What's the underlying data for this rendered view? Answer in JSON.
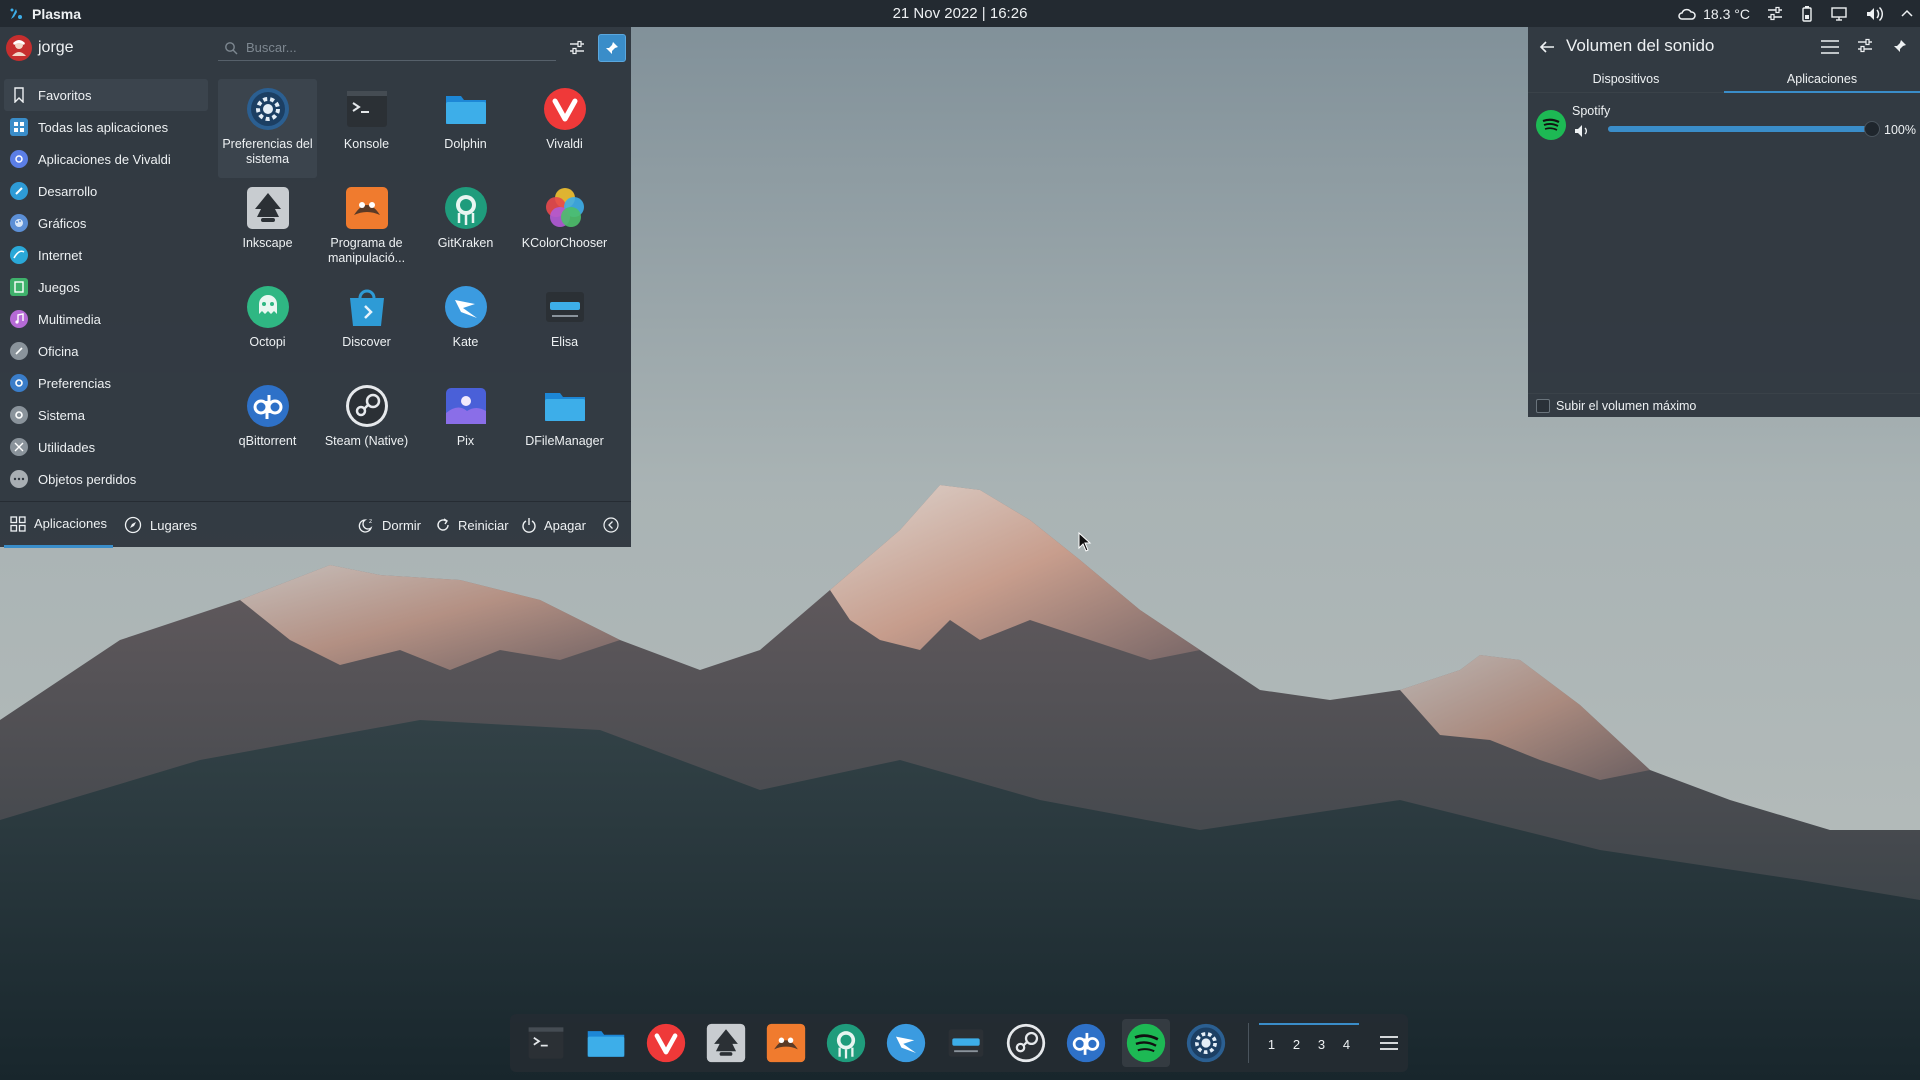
{
  "top_panel": {
    "launcher_label": "Plasma",
    "clock": "21 Nov 2022 | 16:26",
    "weather_temp": "18.3 °C",
    "tray_icons": [
      "weather-icon",
      "settings-sliders-icon",
      "battery-icon",
      "display-icon",
      "volume-icon",
      "chevron-up-icon"
    ]
  },
  "launcher": {
    "user_name": "jorge",
    "search_placeholder": "Buscar...",
    "categories": [
      {
        "label": "Favoritos",
        "icon": "bookmark-icon",
        "color": "#2d353c"
      },
      {
        "label": "Todas las aplicaciones",
        "icon": "grid-icon",
        "color": "#3a8dc9"
      },
      {
        "label": "Aplicaciones de Vivaldi",
        "icon": "vivaldi-folder-icon",
        "color": "#5b7ee6"
      },
      {
        "label": "Desarrollo",
        "icon": "development-icon",
        "color": "#2e9bd6"
      },
      {
        "label": "Gráficos",
        "icon": "graphics-icon",
        "color": "#5c8fd6"
      },
      {
        "label": "Internet",
        "icon": "internet-icon",
        "color": "#2aa8d8"
      },
      {
        "label": "Juegos",
        "icon": "games-icon",
        "color": "#3fb16b"
      },
      {
        "label": "Multimedia",
        "icon": "multimedia-icon",
        "color": "#b66ad6"
      },
      {
        "label": "Oficina",
        "icon": "office-icon",
        "color": "#8a939b"
      },
      {
        "label": "Preferencias",
        "icon": "preferences-icon",
        "color": "#3a7dc9"
      },
      {
        "label": "Sistema",
        "icon": "system-icon",
        "color": "#8a939b"
      },
      {
        "label": "Utilidades",
        "icon": "utilities-icon",
        "color": "#8a939b"
      },
      {
        "label": "Objetos perdidos",
        "icon": "lost-found-icon",
        "color": "#a8aeb3"
      }
    ],
    "apps": [
      {
        "label": "Preferencias del sistema",
        "icon": "system-settings-icon"
      },
      {
        "label": "Konsole",
        "icon": "konsole-icon"
      },
      {
        "label": "Dolphin",
        "icon": "dolphin-folder-icon"
      },
      {
        "label": "Vivaldi",
        "icon": "vivaldi-icon"
      },
      {
        "label": "Inkscape",
        "icon": "inkscape-icon"
      },
      {
        "label": "Programa de manipulació...",
        "icon": "gimp-icon"
      },
      {
        "label": "GitKraken",
        "icon": "gitkraken-icon"
      },
      {
        "label": "KColorChooser",
        "icon": "kcolorchooser-icon"
      },
      {
        "label": "Octopi",
        "icon": "octopi-icon"
      },
      {
        "label": "Discover",
        "icon": "discover-icon"
      },
      {
        "label": "Kate",
        "icon": "kate-icon"
      },
      {
        "label": "Elisa",
        "icon": "elisa-icon"
      },
      {
        "label": "qBittorrent",
        "icon": "qbittorrent-icon"
      },
      {
        "label": "Steam (Native)",
        "icon": "steam-icon"
      },
      {
        "label": "Pix",
        "icon": "pix-icon"
      },
      {
        "label": "DFileManager",
        "icon": "dfilemanager-icon"
      }
    ],
    "footer": {
      "tab_apps": "Aplicaciones",
      "tab_places": "Lugares",
      "sleep": "Dormir",
      "restart": "Reiniciar",
      "shutdown": "Apagar"
    }
  },
  "volume": {
    "title": "Volumen del sonido",
    "tab_devices": "Dispositivos",
    "tab_apps": "Aplicaciones",
    "stream_name": "Spotify",
    "stream_level": 1.0,
    "stream_percent": "100%",
    "raise_max_label": "Subir el volumen máximo"
  },
  "dock": {
    "apps": [
      "konsole-icon",
      "dolphin-folder-icon",
      "vivaldi-icon",
      "inkscape-icon",
      "gimp-icon",
      "gitkraken-icon",
      "kate-icon",
      "elisa-icon",
      "steam-icon",
      "qbittorrent-icon",
      "spotify-icon",
      "system-settings-icon"
    ],
    "desktops": [
      "1",
      "2",
      "3",
      "4"
    ]
  },
  "colors": {
    "accent": "#3a8dc9",
    "panel": "#232a31",
    "popup": "#2f373f",
    "spotify": "#1db954"
  }
}
